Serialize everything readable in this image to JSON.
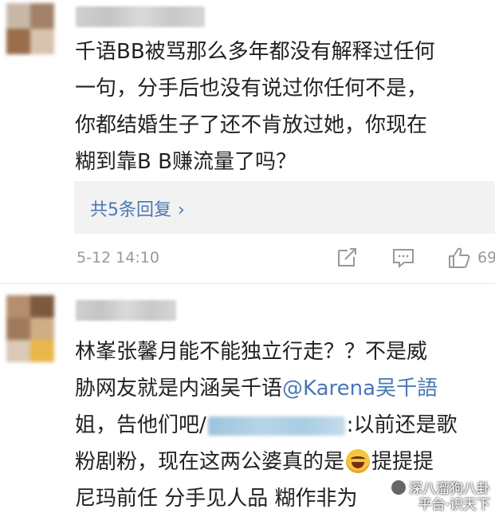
{
  "comments": [
    {
      "lines": [
        "千语BB被骂那么多年都没有解释过任何",
        "一句，分手后也没有说过你任何不是，",
        "你都结婚生子了还不肯放过她，你现在",
        "糊到靠B B赚流量了吗？"
      ],
      "reply_link": "共5条回复",
      "reply_chevron": "›",
      "timestamp": "5-12 14:10",
      "like_count": "69"
    },
    {
      "line1": "林峯张馨月能不能独立行走？？不是威",
      "line2_pre": "胁网友就是内涵吴千语",
      "line2_mention": "@Karena吴千語",
      "line3_pre": "姐，告他们吧/",
      "line3_post": ":以前还是歌",
      "line4_pre": "粉剧粉，现在这两公婆真的是",
      "line4_post": "提提提",
      "line5": "尼玛前任 分手见人品 糊作非为"
    }
  ],
  "watermark": {
    "line1": "深八溜狗八卦",
    "line2": "平台·识天下"
  },
  "colors": {
    "link": "#4a78b2",
    "meta": "#999999",
    "reply_bg": "#f2f2f2"
  },
  "icons": [
    "share-icon",
    "comment-icon",
    "like-icon",
    "laugh-emoji"
  ]
}
